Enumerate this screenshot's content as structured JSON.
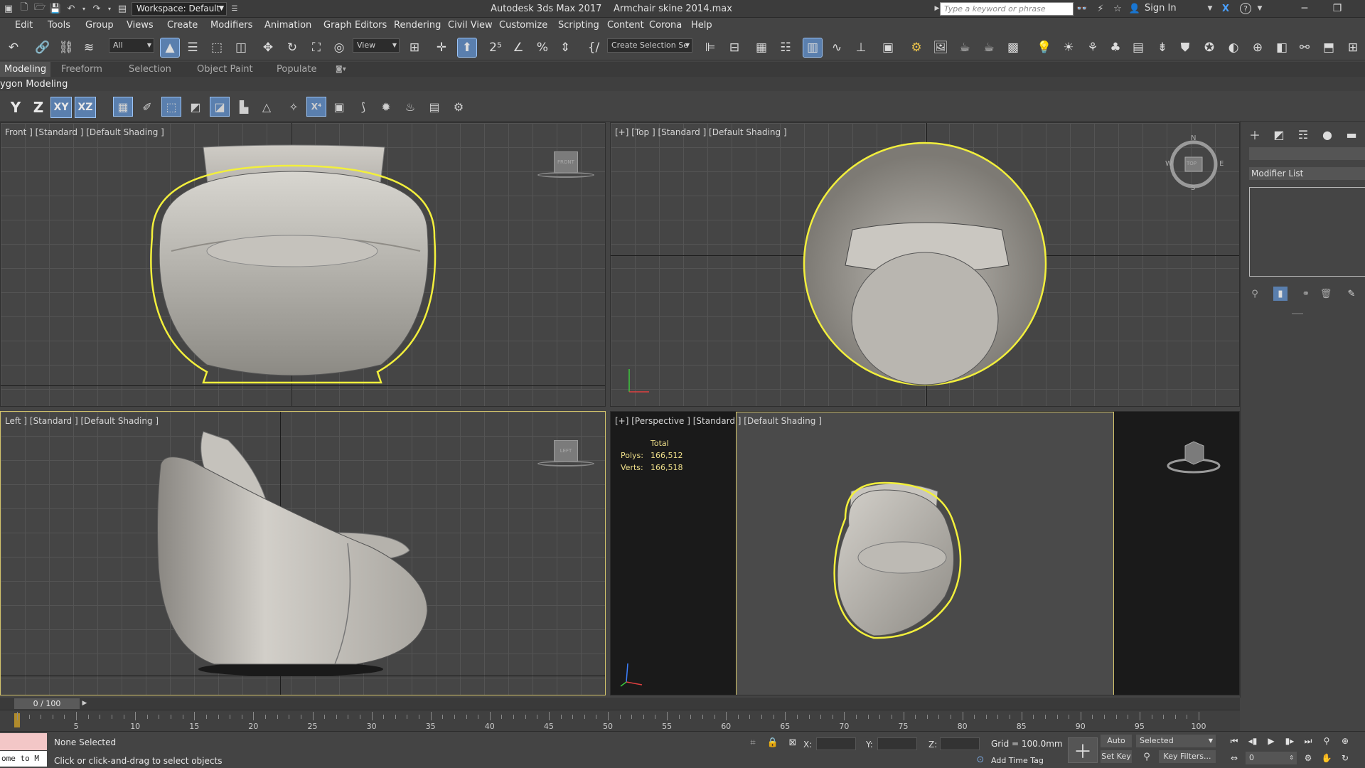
{
  "titlebar": {
    "workspace": "Workspace: Default",
    "app": "Autodesk 3ds Max 2017",
    "file": "Armchair skine  2014.max",
    "search_placeholder": "Type a keyword or phrase",
    "sign_in": "Sign In"
  },
  "menu": [
    "Edit",
    "Tools",
    "Group",
    "Views",
    "Create",
    "Modifiers",
    "Animation",
    "Graph Editors",
    "Rendering",
    "Civil View",
    "Customize",
    "Scripting",
    "Content",
    "Corona",
    "Help"
  ],
  "main_toolbar": {
    "selection_filter": "All",
    "reference_coord": "View",
    "selection_set": "Create Selection Se"
  },
  "ribbon": {
    "tabs": [
      "Modeling",
      "Freeform",
      "Selection",
      "Object Paint",
      "Populate"
    ],
    "active_tab": "Modeling",
    "panel_label": "ygon Modeling"
  },
  "axis_toolbar": {
    "y": "Y",
    "z": "Z",
    "xy": "XY",
    "xz": "XZ"
  },
  "viewports": {
    "front": {
      "label": "Front ] [Standard ] [Default Shading ]",
      "cube": "FRONT"
    },
    "top": {
      "label": "[+] [Top ] [Standard ] [Default Shading ]",
      "compass": {
        "n": "N",
        "s": "S",
        "e": "E",
        "w": "W"
      },
      "cube": "TOP"
    },
    "left": {
      "label": "Left ] [Standard ] [Default Shading ]",
      "cube": "LEFT"
    },
    "perspective": {
      "label": "[+] [Perspective ] [Standard ] [Default Shading ]",
      "stats": {
        "header": "Total",
        "polys_label": "Polys:",
        "polys": "166,512",
        "verts_label": "Verts:",
        "verts": "166,518"
      }
    }
  },
  "command_panel": {
    "modifier_list": "Modifier List"
  },
  "timeline": {
    "frame": "0 / 100",
    "ticks": [
      "5",
      "10",
      "15",
      "20",
      "25",
      "30",
      "35",
      "40",
      "45",
      "50",
      "55",
      "60",
      "65",
      "70",
      "75",
      "80",
      "85",
      "90",
      "95",
      "100"
    ]
  },
  "status": {
    "maxscript": "ome to M",
    "selection": "None Selected",
    "prompt": "Click or click-and-drag to select objects",
    "x_label": "X:",
    "y_label": "Y:",
    "z_label": "Z:",
    "grid": "Grid = 100.0mm",
    "add_time_tag": "Add Time Tag",
    "auto_key": "Auto Key",
    "set_key": "Set Key",
    "selected": "Selected",
    "key_filters": "Key Filters...",
    "frame_field": "0"
  },
  "colors": {
    "accent_blue": "#5a7fae",
    "selection_yellow": "#f2ef3c",
    "stats_yellow": "#f0e08a"
  }
}
